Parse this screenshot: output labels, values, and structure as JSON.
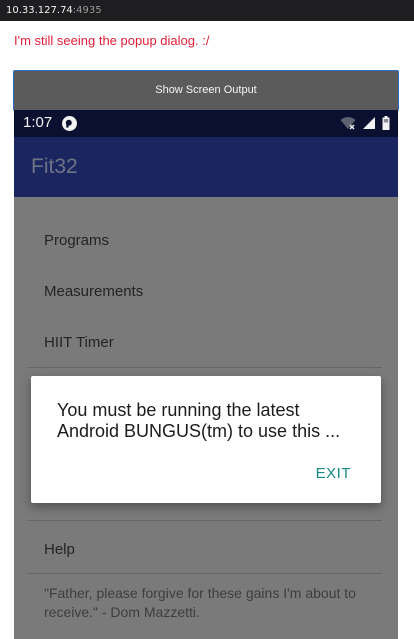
{
  "browser": {
    "address_host": "10.33.127.74",
    "address_port": ":4935"
  },
  "page": {
    "error_message": "I'm still seeing the popup dialog. :/",
    "show_output_button": "Show Screen Output"
  },
  "phone": {
    "status_bar": {
      "time": "1:07",
      "icons": [
        "app-notification-icon",
        "wifi-off-icon",
        "signal-icon",
        "battery-icon"
      ]
    },
    "app_bar": {
      "title": "Fit32",
      "color": "#1b2560"
    },
    "menu_items": [
      {
        "label": "Programs"
      },
      {
        "label": "Measurements"
      },
      {
        "label": "HIIT Timer"
      },
      {
        "label": "Help"
      }
    ],
    "quote": "\"Father, please forgive for these gains I'm about to receive.\" - Dom Mazzetti.",
    "dialog": {
      "message_line1": "You must be running the latest",
      "message_line2": "Android BUNGUS(tm) to use this ...",
      "exit_label": "EXIT",
      "accent": "#138a85"
    }
  }
}
